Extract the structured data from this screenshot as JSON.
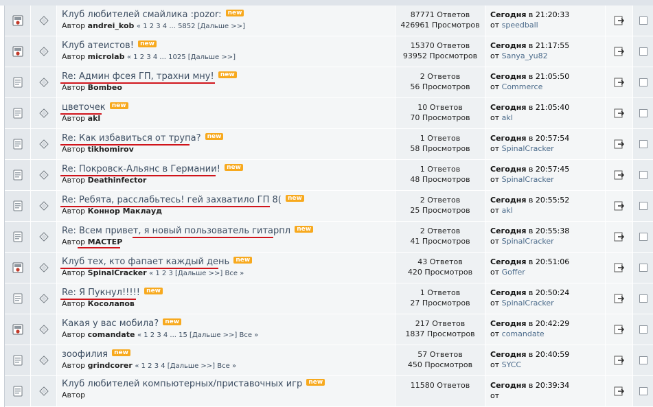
{
  "labels": {
    "author_prefix": "Автор",
    "from_prefix": "от",
    "next": "[Дальше >>]",
    "all": "Все »"
  },
  "rows": [
    {
      "icon_status": "hot-folder-icon",
      "title": "Клуб любителей смайлика :pozor:",
      "new": "new",
      "author": "andrei_kob",
      "pages": "« 1 2 3 4 ... 5852",
      "has_next": true,
      "has_all": false,
      "replies": "87771 Ответов",
      "views": "426961 Просмотров",
      "date": "Сегодня",
      "time": "в 21:20:33",
      "last_user": "speedball"
    },
    {
      "icon_status": "hot-folder-icon",
      "title": "Клуб атеистов!",
      "new": "new",
      "author": "microlab",
      "pages": "« 1 2 3 4 ... 1025",
      "has_next": true,
      "has_all": false,
      "replies": "15370 Ответов",
      "views": "93952 Просмотров",
      "date": "Сегодня",
      "time": "в 21:17:55",
      "last_user": "Sanya_yu82"
    },
    {
      "icon_status": "folder-icon",
      "title": "Re: Админ фсея ГП, трахни мну!",
      "new": "new",
      "author": "Bombeo",
      "pages": "",
      "has_next": false,
      "has_all": false,
      "replies": "2 Ответов",
      "views": "56 Просмотров",
      "date": "Сегодня",
      "time": "в 21:05:50",
      "last_user": "Commerce"
    },
    {
      "icon_status": "folder-icon",
      "title": "цветочек",
      "new": "new",
      "author": "akl",
      "pages": "",
      "has_next": false,
      "has_all": false,
      "replies": "10 Ответов",
      "views": "70 Просмотров",
      "date": "Сегодня",
      "time": "в 21:05:40",
      "last_user": "akl"
    },
    {
      "icon_status": "folder-icon",
      "title": "Re: Как избавиться от трупа?",
      "new": "new",
      "author": "tikhomirov",
      "pages": "",
      "has_next": false,
      "has_all": false,
      "replies": "1 Ответов",
      "views": "58 Просмотров",
      "date": "Сегодня",
      "time": "в 20:57:54",
      "last_user": "SpinalCracker"
    },
    {
      "icon_status": "folder-icon",
      "title": "Re: Покровск-Альянс в Германии!",
      "new": "new",
      "author": "Deathinfector",
      "pages": "",
      "has_next": false,
      "has_all": false,
      "replies": "1 Ответов",
      "views": "48 Просмотров",
      "date": "Сегодня",
      "time": "в 20:57:45",
      "last_user": "SpinalCracker"
    },
    {
      "icon_status": "folder-icon",
      "title": "Re: Ребята, расслабьтесь! гей захватило ГП 8(",
      "new": "new",
      "author": "Коннор Маклауд",
      "pages": "",
      "has_next": false,
      "has_all": false,
      "replies": "2 Ответов",
      "views": "25 Просмотров",
      "date": "Сегодня",
      "time": "в 20:55:52",
      "last_user": "akl"
    },
    {
      "icon_status": "folder-icon",
      "title": "Re: Всем привет, я новый пользователь гитарпл",
      "new": "new",
      "author": "МАСТЕР",
      "pages": "",
      "has_next": false,
      "has_all": false,
      "replies": "2 Ответов",
      "views": "41 Просмотров",
      "date": "Сегодня",
      "time": "в 20:55:38",
      "last_user": "SpinalCracker"
    },
    {
      "icon_status": "hot-folder-icon",
      "title": "Клуб тех, кто фапает каждый день",
      "new": "new",
      "author": "SpinalCracker",
      "pages": "« 1 2 3",
      "has_next": true,
      "has_all": true,
      "replies": "43 Ответов",
      "views": "420 Просмотров",
      "date": "Сегодня",
      "time": "в 20:51:06",
      "last_user": "Goffer"
    },
    {
      "icon_status": "folder-icon",
      "title": "Re: Я Пукнул!!!!!",
      "new": "new",
      "author": "Косолапов",
      "pages": "",
      "has_next": false,
      "has_all": false,
      "replies": "1 Ответов",
      "views": "27 Просмотров",
      "date": "Сегодня",
      "time": "в 20:50:24",
      "last_user": "SpinalCracker"
    },
    {
      "icon_status": "hot-folder-icon",
      "title": "Какая у вас мобила?",
      "new": "new",
      "author": "comandate",
      "pages": "« 1 2 3 4 ... 15",
      "has_next": true,
      "has_all": true,
      "replies": "217 Ответов",
      "views": "1837 Просмотров",
      "date": "Сегодня",
      "time": "в 20:42:29",
      "last_user": "comandate"
    },
    {
      "icon_status": "folder-icon",
      "title": "зоофилия",
      "new": "new",
      "author": "grindcorer",
      "pages": "« 1 2 3 4",
      "has_next": true,
      "has_all": true,
      "replies": "57 Ответов",
      "views": "450 Просмотров",
      "date": "Сегодня",
      "time": "в 20:40:59",
      "last_user": "SYCC"
    },
    {
      "icon_status": "folder-icon",
      "title": "Клуб любителей компьютерных/приставочных игр",
      "new": "new",
      "author": "",
      "pages": "",
      "has_next": false,
      "has_all": false,
      "replies": "11580 Ответов",
      "views": "",
      "date": "Сегодня",
      "time": "в 20:39:34",
      "last_user": ""
    }
  ]
}
